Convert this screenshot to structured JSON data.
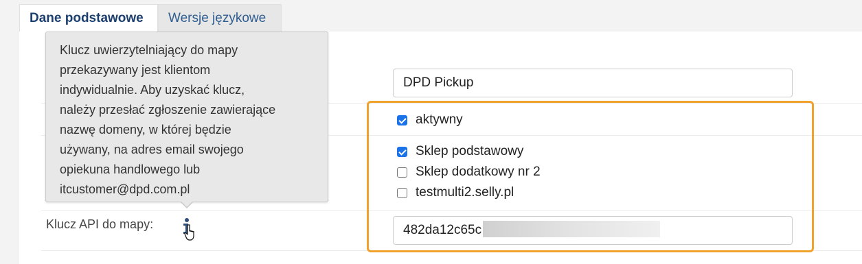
{
  "tabs": [
    {
      "label": "Dane podstawowe",
      "active": true
    },
    {
      "label": "Wersje językowe",
      "active": false
    }
  ],
  "form": {
    "name_value": "DPD Pickup",
    "active": {
      "label": "aktywny",
      "checked": true
    },
    "shops": [
      {
        "label": "Sklep podstawowy",
        "checked": true
      },
      {
        "label": "Sklep dodatkowy nr 2",
        "checked": false
      },
      {
        "label": "testmulti2.selly.pl",
        "checked": false
      }
    ],
    "api_key_label": "Klucz API do mapy:",
    "api_key_value": "482da12c65c"
  },
  "tooltip": {
    "lines": [
      "Klucz uwierzytelniający do mapy",
      "przekazywany jest klientom",
      "indywidualnie. Aby uzyskać klucz,",
      "należy przesłać zgłoszenie zawierające",
      "nazwę domeny, w której będzie",
      "używany, na adres email swojego",
      "opiekuna handlowego lub",
      "itcustomer@dpd.com.pl"
    ]
  },
  "icons": {
    "info": "info-icon",
    "cursor": "hand-pointer-icon"
  },
  "colors": {
    "highlight": "#f0a22c",
    "checkbox": "#1a73e8",
    "active_tab_text": "#1c3f6e",
    "inactive_tab_text": "#2f5d8f"
  }
}
